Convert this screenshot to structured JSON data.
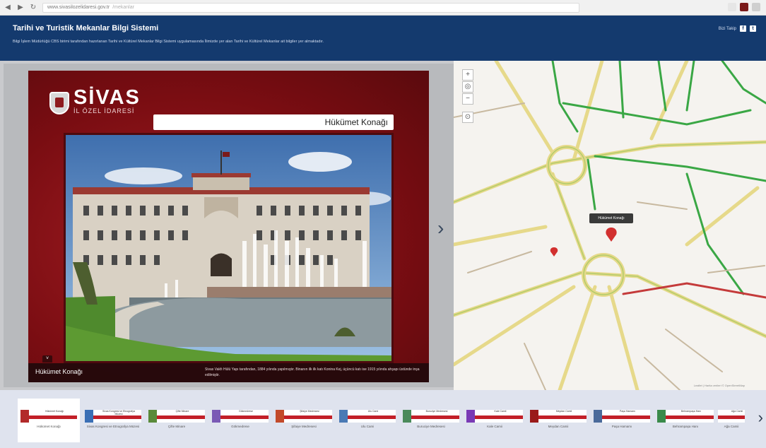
{
  "browser": {
    "back_icon": "arrow-left-icon",
    "url_display": "www.sivasilozelidaresi.gov.tr",
    "url_suffix": "/mekanlar"
  },
  "header": {
    "title": "Tarihi ve Turistik Mekanlar Bilgi Sistemi",
    "description": "Bilgi İşlem Müdürlüğü CBS birimi tarafından hazırlanan Tarihi ve Kültürel Mekanlar Bilgi Sistemi uygulamasında İlimizde yer alan Tarihi ve Kültürel Mekanlar ait bilgiler yer almaktadır.",
    "share_label": "Bizi Takip",
    "social": [
      "f",
      "t"
    ]
  },
  "slide": {
    "logo_text": "SİVAS",
    "logo_sub": "İL ÖZEL İDARESİ",
    "place_title": "Hükümet Konağı",
    "caption_title": "Hükümet Konağı",
    "caption_desc": "Sivas Vakfı Hülü Yapı tarafından, 1884 yılında yapılmıştır. Binanın ilk ilk katı Konina Kej, üçüncü katı ise 1915 yılında ahşapı üstünde inşa edilmiştir.",
    "toggle_icon": "chevron-down-icon",
    "next_icon": "chevron-right-icon"
  },
  "map": {
    "controls": [
      "+",
      "◎",
      "−",
      "⊙"
    ],
    "popup_label": "Hükümet Konağı",
    "attribution": "Leaflet | Harita verileri © OpenStreetMap"
  },
  "thumbnails": [
    {
      "label": "Hükümet Konağı",
      "color": "#b22a2a"
    },
    {
      "label": "Sivas Kongresi ve Etnografya Müzesi",
      "color": "#3a6fb5"
    },
    {
      "label": "Çifte Minare",
      "color": "#5a8a3a"
    },
    {
      "label": "Gökmedrese",
      "color": "#7a5ab5"
    },
    {
      "label": "Şifaiye Medresesi",
      "color": "#c24a2a"
    },
    {
      "label": "Ulu Cami",
      "color": "#4a7ab5"
    },
    {
      "label": "Buruciye Medresesi",
      "color": "#4a8a5a"
    },
    {
      "label": "Kale Camii",
      "color": "#7a3ab5"
    },
    {
      "label": "Meydan Camii",
      "color": "#9a1a1a"
    },
    {
      "label": "Paşa Hamamı",
      "color": "#4a6a9a"
    },
    {
      "label": "Behrampaşa Hanı",
      "color": "#3a8a4a"
    },
    {
      "label": "Ağa Camii",
      "color": "#8a4ab5"
    }
  ],
  "strip_arrow_icon": "chevron-right-icon"
}
